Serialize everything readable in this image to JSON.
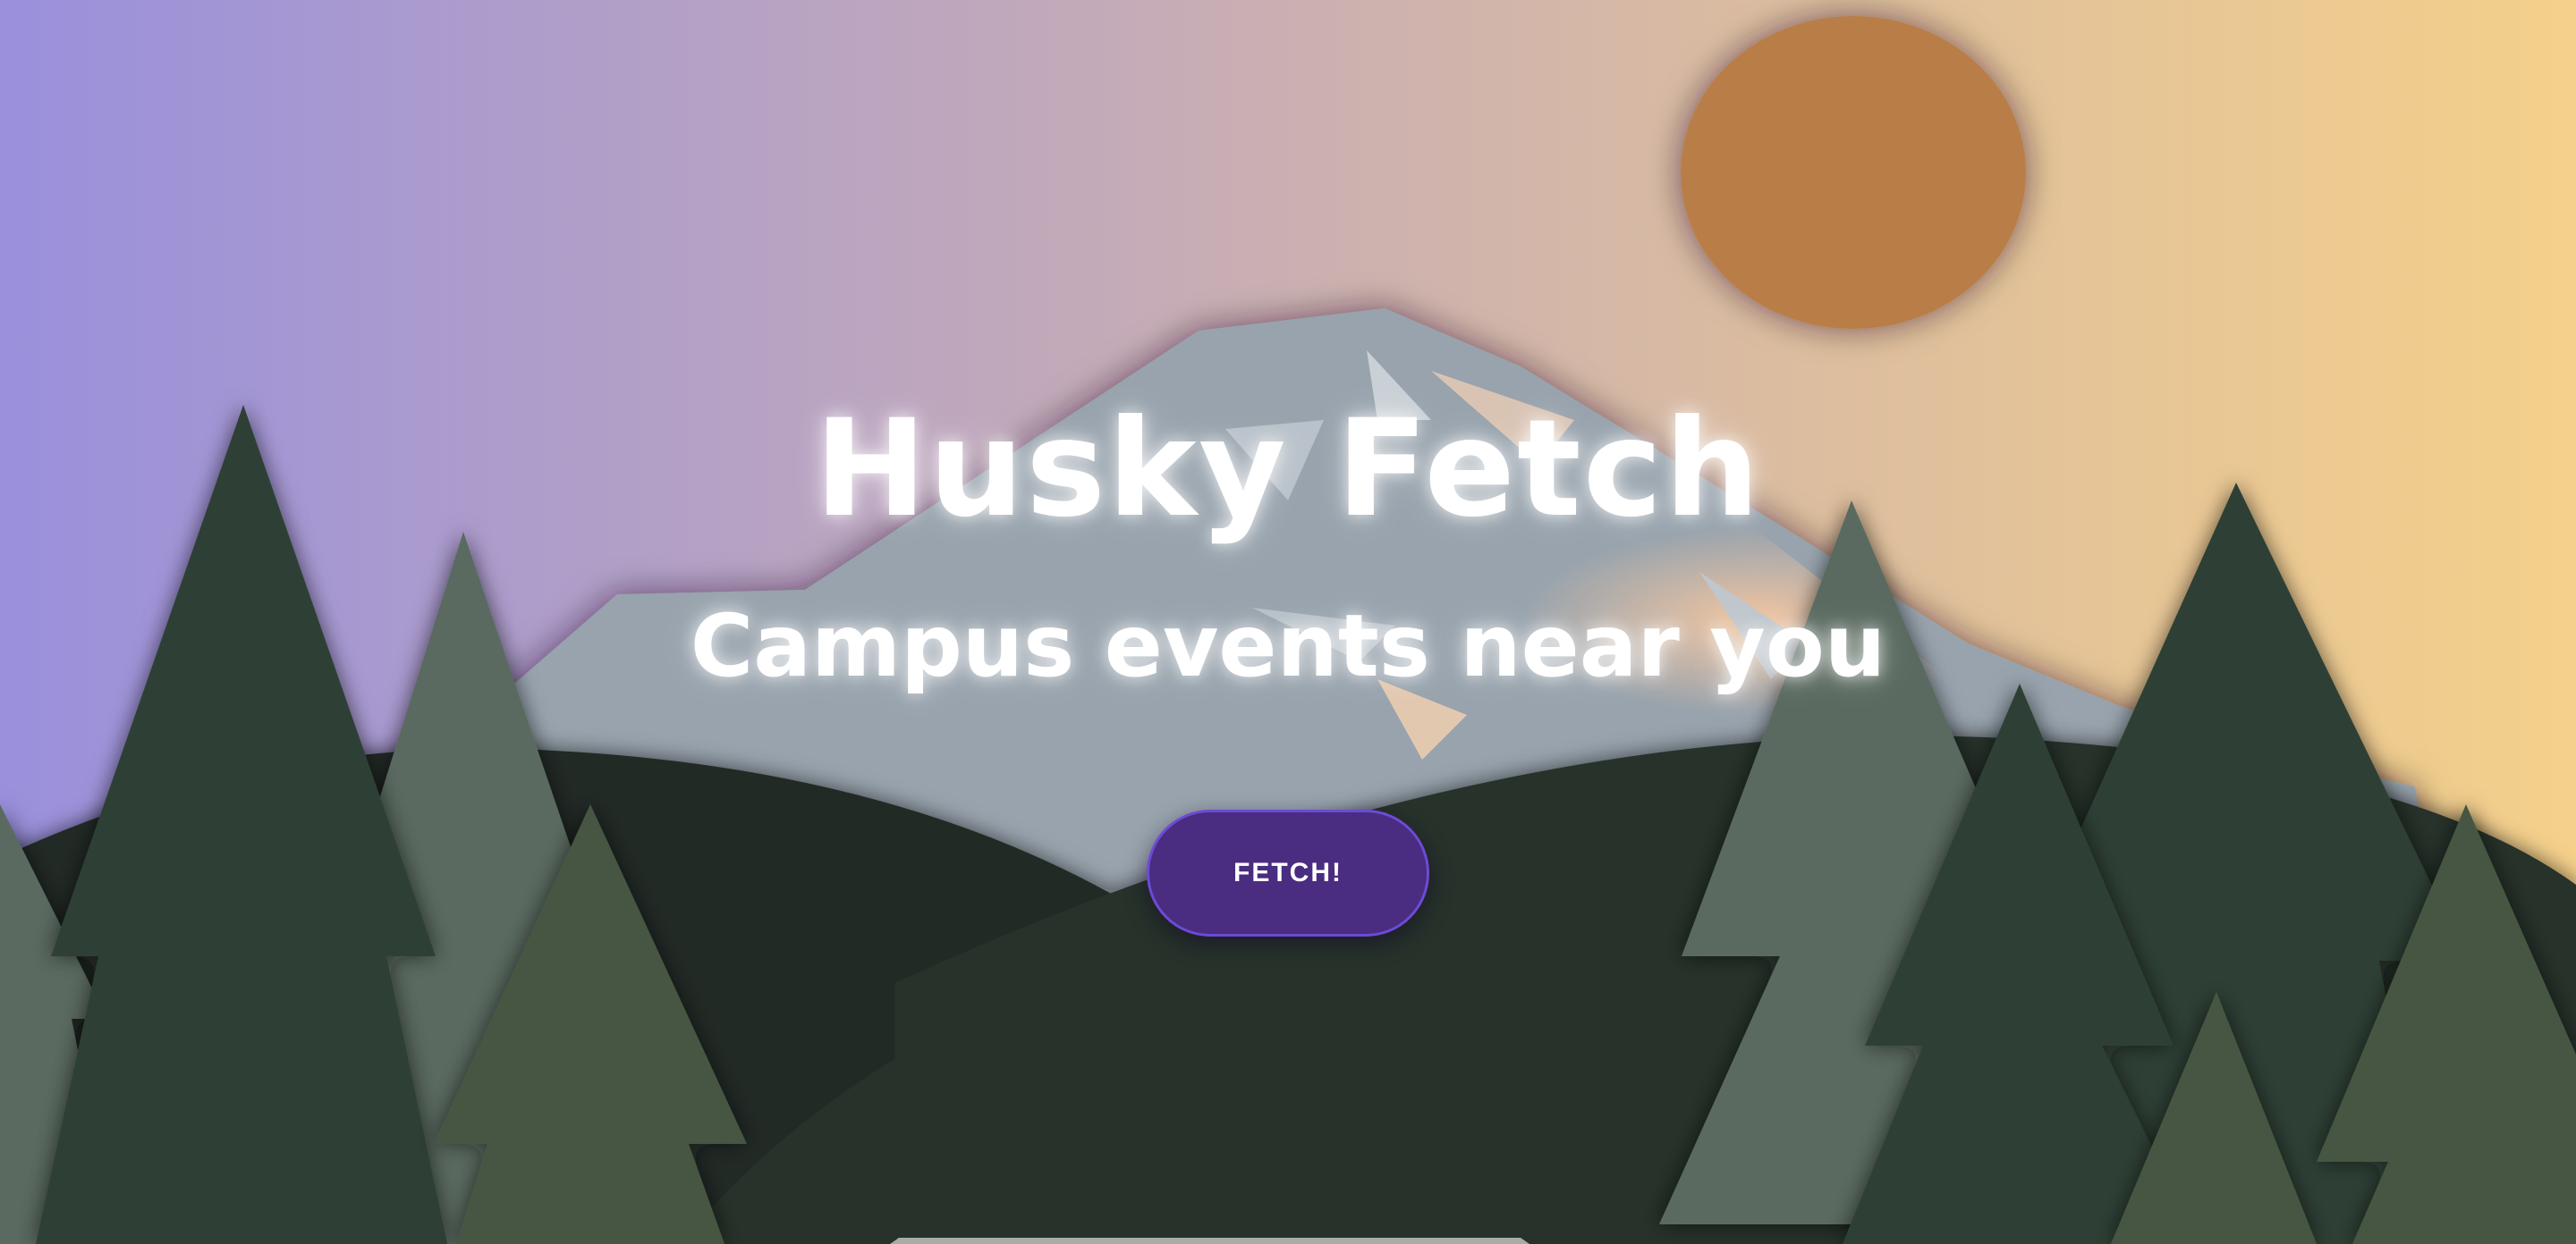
{
  "hero": {
    "title": "Husky Fetch",
    "subtitle": "Campus events near you",
    "button_label": "FETCH!"
  },
  "colors": {
    "sky_left": "#9a90dc",
    "sky_right": "#f4d08a",
    "sun": "#b97e47",
    "mountain": "#98a3ad",
    "hill_dark": "#263029",
    "tree_dark": "#2d4034",
    "tree_light": "#5a6b60",
    "tree_olive": "#475743",
    "button_bg": "#4a2c80",
    "button_border": "#6b4bd6"
  }
}
